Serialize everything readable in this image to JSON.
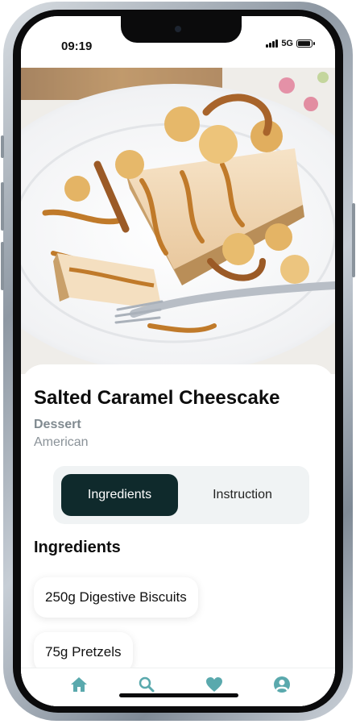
{
  "status_bar": {
    "time": "09:19",
    "network": "5G"
  },
  "recipe": {
    "title": "Salted Caramel Cheescake",
    "category": "Dessert",
    "area": "American",
    "image_alt": "salted-caramel-cheesecake-photo"
  },
  "tabs": [
    {
      "label": "Ingredients",
      "active": true
    },
    {
      "label": "Instruction",
      "active": false
    }
  ],
  "ingredients_section": {
    "heading": "Ingredients",
    "items": [
      "250g Digestive Biscuits",
      "75g Pretzels"
    ]
  },
  "bottom_nav": [
    {
      "icon": "home-icon",
      "active": true
    },
    {
      "icon": "search-icon",
      "active": false
    },
    {
      "icon": "heart-icon",
      "active": false
    },
    {
      "icon": "profile-icon",
      "active": false
    }
  ],
  "colors": {
    "accent": "#0f2a2c",
    "nav_icon": "#5aa9ad",
    "caramel": "#c07a2a"
  }
}
